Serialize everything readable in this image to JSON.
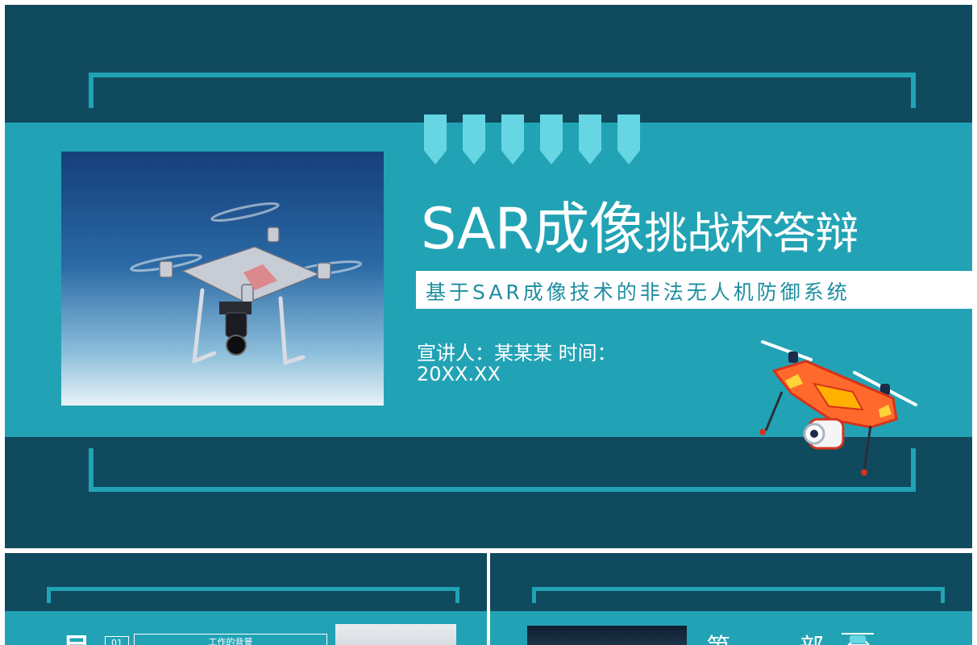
{
  "cover": {
    "title_part1": "SAR成像",
    "title_part2": "挑战杯答辩",
    "subtitle": "基于SAR成像技术的非法无人机防御系统",
    "speaker_line": "宣讲人：某某某   时间：",
    "date_line": "20XX.XX"
  },
  "toc_slide": {
    "heading_char": "目",
    "item_number": "01",
    "item_label": "工作的背景"
  },
  "section_slide": {
    "heading": "第一部分"
  },
  "colors": {
    "dark_teal": "#0f4a5e",
    "teal": "#22a3b5",
    "light_teal": "#66d6e3",
    "white": "#ffffff"
  },
  "icons": [
    "drone-photo",
    "cartoon-drone-icon"
  ]
}
